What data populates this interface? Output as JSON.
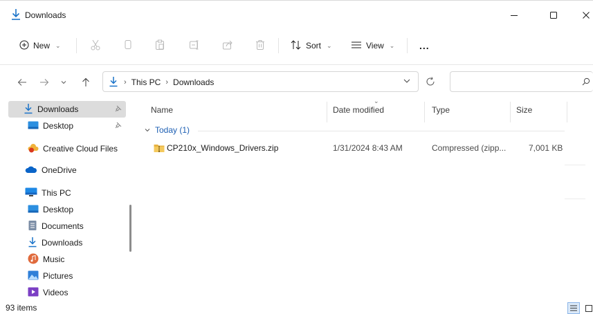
{
  "window": {
    "title": "Downloads",
    "accent": "#1a73c9"
  },
  "toolbar": {
    "new_label": "New",
    "sort_label": "Sort",
    "view_label": "View",
    "more_label": "...",
    "icons": [
      "cut-icon",
      "copy-icon",
      "paste-icon",
      "rename-icon",
      "share-icon",
      "delete-icon"
    ]
  },
  "address": {
    "crumbs": [
      "This PC",
      "Downloads"
    ],
    "search_placeholder": ""
  },
  "sidebar": {
    "quick_access": [
      {
        "label": "Downloads",
        "icon": "download-arrow-icon",
        "pinned": true,
        "selected": true
      },
      {
        "label": "Desktop",
        "icon": "desktop-folder-icon",
        "pinned": true
      }
    ],
    "creative_cloud": {
      "label": "Creative Cloud Files",
      "icon": "creative-cloud-icon"
    },
    "onedrive": {
      "label": "OneDrive",
      "icon": "onedrive-cloud-icon"
    },
    "this_pc": {
      "label": "This PC",
      "icon": "monitor-icon"
    },
    "pc_items": [
      {
        "label": "Desktop",
        "icon": "desktop-folder-icon"
      },
      {
        "label": "Documents",
        "icon": "documents-icon"
      },
      {
        "label": "Downloads",
        "icon": "download-arrow-icon"
      },
      {
        "label": "Music",
        "icon": "music-icon"
      },
      {
        "label": "Pictures",
        "icon": "pictures-icon"
      },
      {
        "label": "Videos",
        "icon": "videos-icon"
      }
    ]
  },
  "columns": {
    "name": "Name",
    "date": "Date modified",
    "type": "Type",
    "size": "Size"
  },
  "group": {
    "label": "Today (1)"
  },
  "files": [
    {
      "name": "CP210x_Windows_Drivers.zip",
      "date": "1/31/2024 8:43 AM",
      "type": "Compressed (zipp...",
      "size": "7,001 KB",
      "icon": "zip-folder-icon"
    }
  ],
  "status": {
    "count": "93 items"
  }
}
